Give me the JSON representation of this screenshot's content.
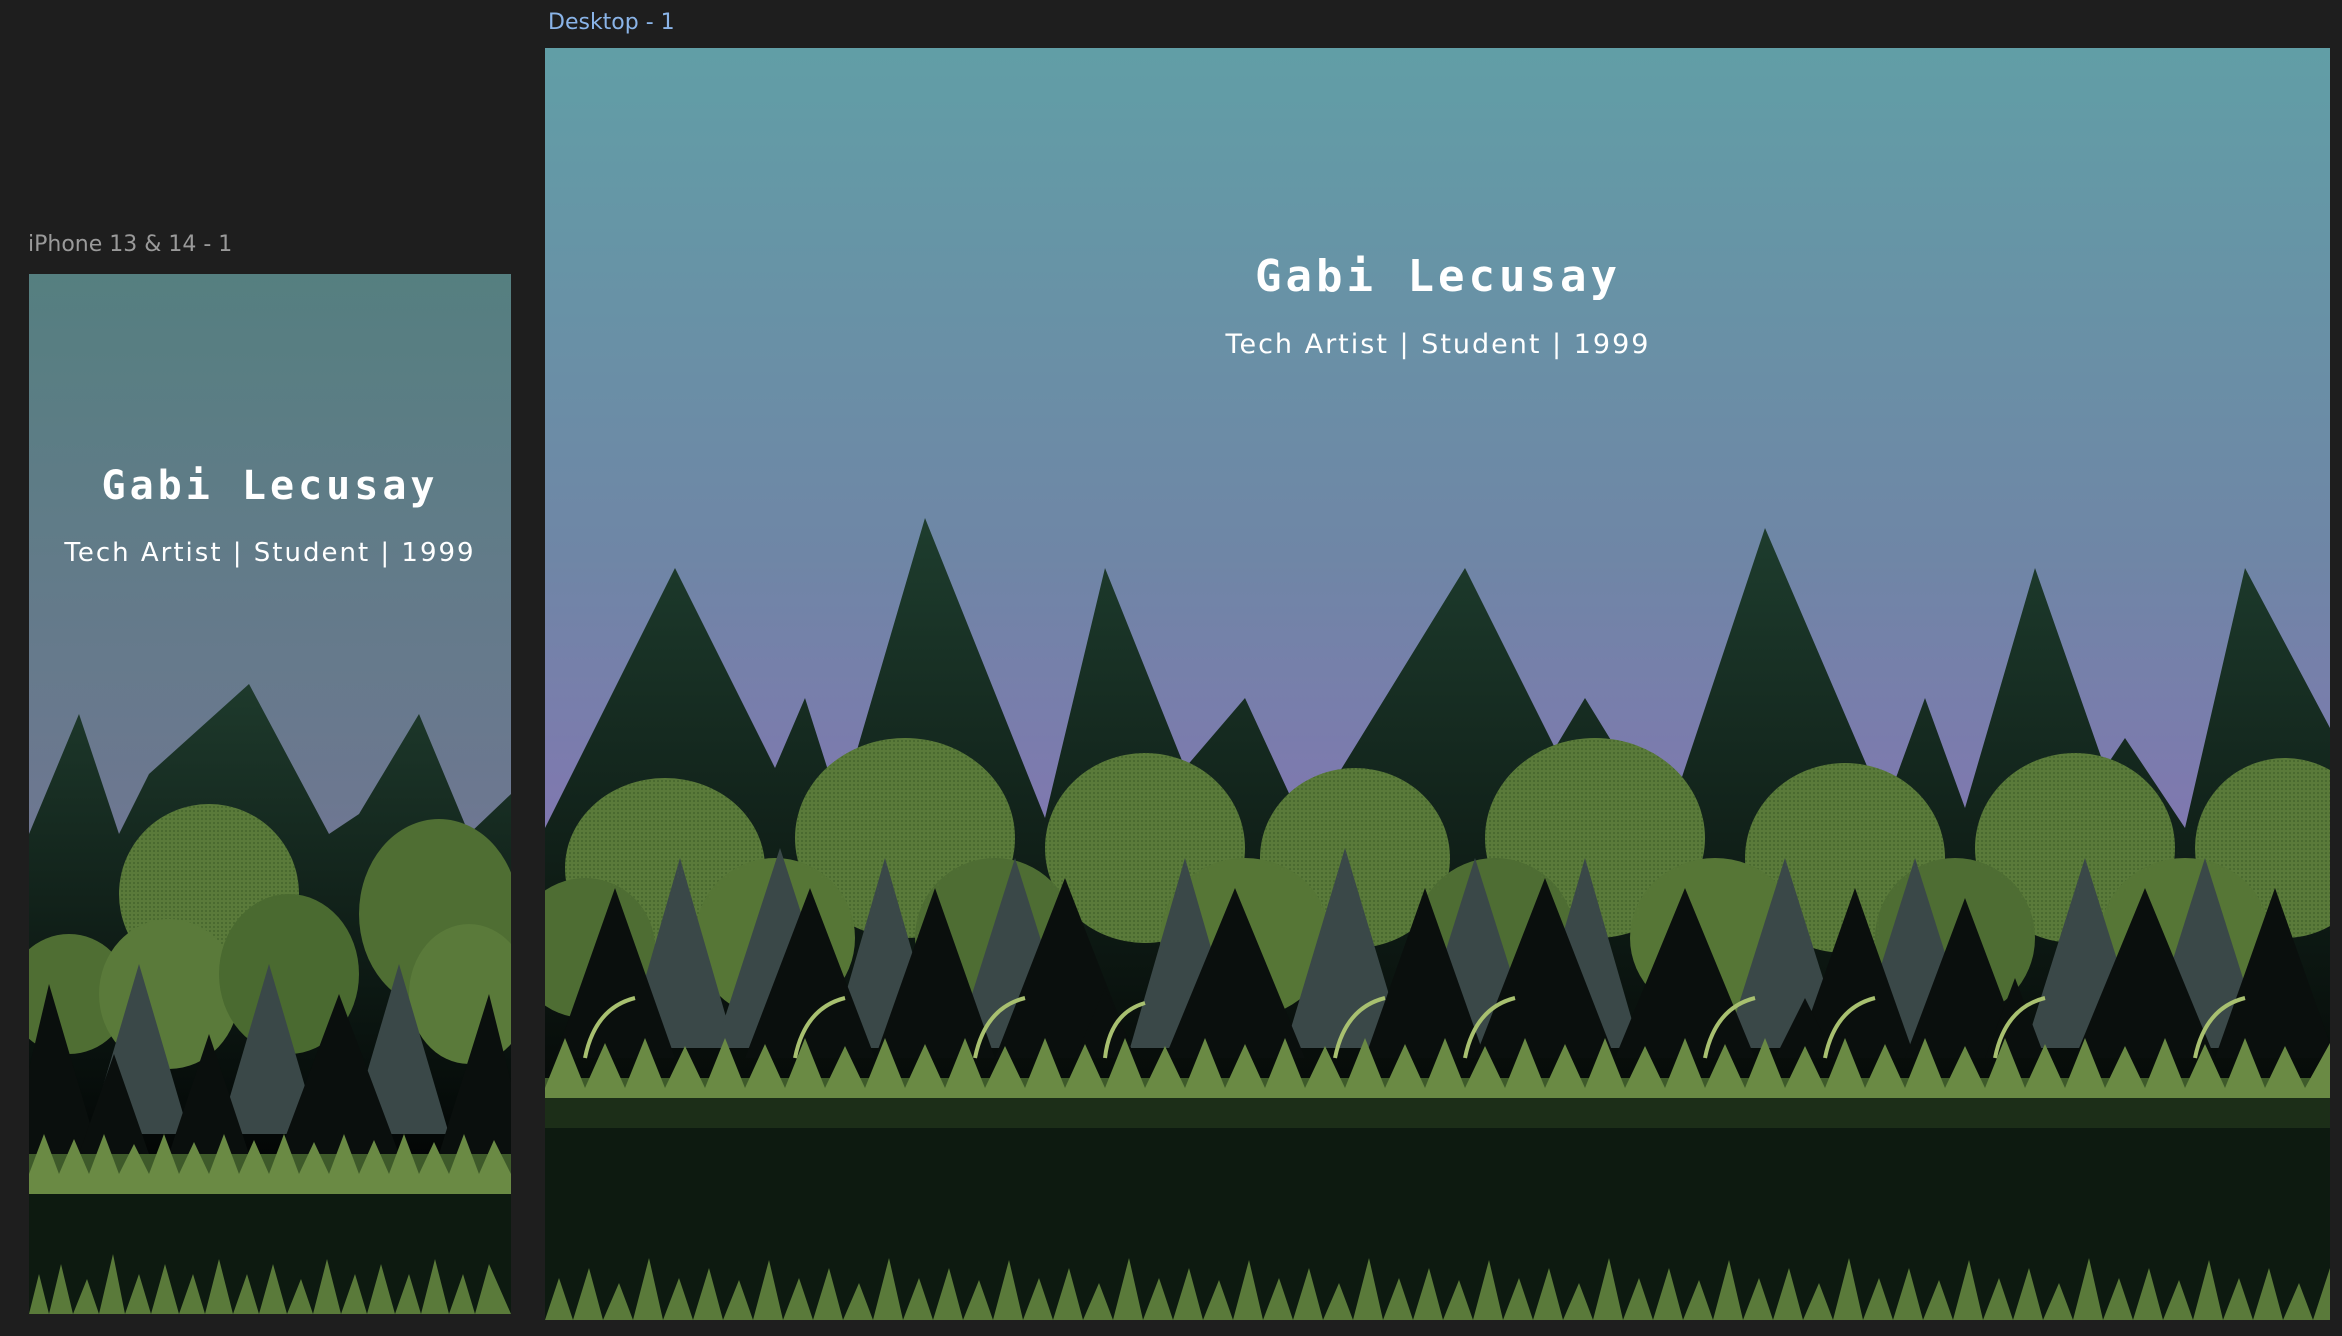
{
  "canvas": {
    "background": "#1e1e1e",
    "selection_color": "#2f7fdc"
  },
  "frames": {
    "mobile": {
      "label": "iPhone 13 & 14 - 1",
      "label_color": "#9a9a9a",
      "title": "Gabi Lecusay",
      "subtitle": "Tech Artist | Student | 1999"
    },
    "desktop": {
      "label": "Desktop - 1",
      "label_color": "#8ab4e8",
      "title": "Gabi Lecusay",
      "subtitle": "Tech Artist | Student | 1999",
      "selected": true
    }
  },
  "palette": {
    "sky_top": "#62a0a8",
    "sky_mid": "#7a78a8",
    "sky_low": "#8a6eb8",
    "mountain": "#1d3a2c",
    "mountain_shadow": "#0c1a14",
    "bush_light": "#5a7a3a",
    "bush_dark": "#3e5a2a",
    "pine_gray": "#3a4848",
    "pine_dark": "#0a0f0d",
    "grass": "#6a8a44",
    "ground": "#0d1a10"
  }
}
